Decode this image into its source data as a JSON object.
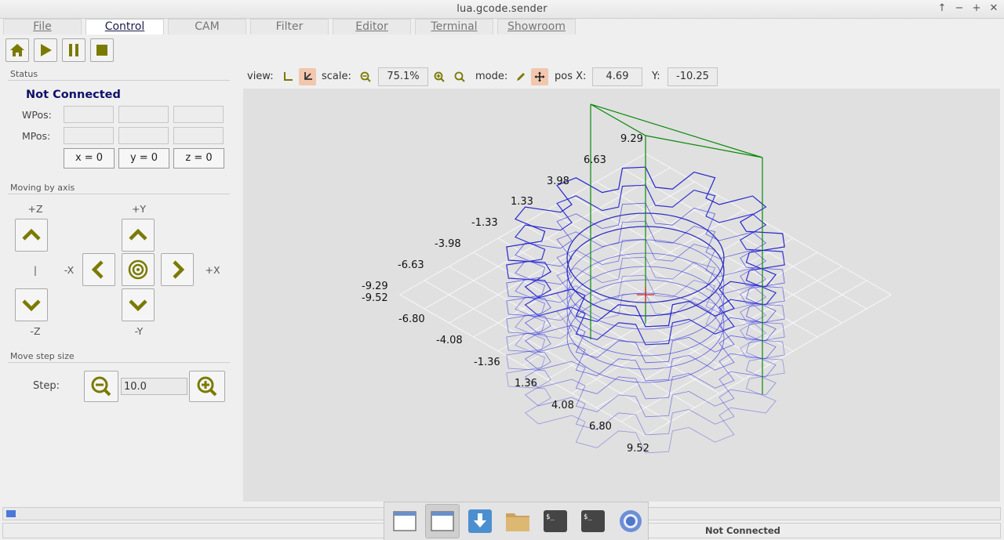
{
  "window": {
    "title": "lua.gcode.sender"
  },
  "tabs": [
    {
      "label": "File",
      "active": false
    },
    {
      "label": "Control",
      "active": true
    },
    {
      "label": "CAM",
      "active": false
    },
    {
      "label": "Filter",
      "active": false
    },
    {
      "label": "Editor",
      "active": false
    },
    {
      "label": "Terminal",
      "active": false
    },
    {
      "label": "Showroom",
      "active": false
    }
  ],
  "toolbar": {
    "icons": [
      "home-icon",
      "play-icon",
      "pause-icon",
      "stop-icon"
    ],
    "icon_color": "#7a7a00"
  },
  "status": {
    "section_title": "Status",
    "connection": "Not Connected",
    "wpos_label": "WPos:",
    "mpos_label": "MPos:",
    "zero_buttons": [
      "x = 0",
      "y = 0",
      "z = 0"
    ]
  },
  "moving": {
    "section_title": "Moving by axis",
    "plus_z": "+Z",
    "minus_z": "-Z",
    "z_sep": "|",
    "plus_y": "+Y",
    "minus_y": "-Y",
    "minus_x": "-X",
    "plus_x": "+X"
  },
  "step": {
    "section_title": "Move step size",
    "label": "Step:",
    "value": "10.0"
  },
  "view": {
    "view_label": "view:",
    "scale_label": "scale:",
    "scale_value": "75.1%",
    "mode_label": "mode:",
    "posx_label": "pos X:",
    "posx_value": "4.69",
    "posy_label": "Y:",
    "posy_value": "-10.25"
  },
  "axis_ticks": {
    "y_axis": [
      "9.29",
      "6.63",
      "3.98",
      "1.33",
      "-1.33",
      "-3.98",
      "-6.63",
      "-9.29"
    ],
    "x_axis": [
      "-9.52",
      "-6.80",
      "-4.08",
      "-1.36",
      "1.36",
      "4.08",
      "6.80",
      "9.52"
    ]
  },
  "statusbar": {
    "text": "Not Connected"
  },
  "dock": {
    "items": [
      "window-icon",
      "window-icon",
      "download-icon",
      "folder-icon",
      "terminal-icon",
      "terminal-icon",
      "browser-icon"
    ],
    "active_index": 1
  }
}
